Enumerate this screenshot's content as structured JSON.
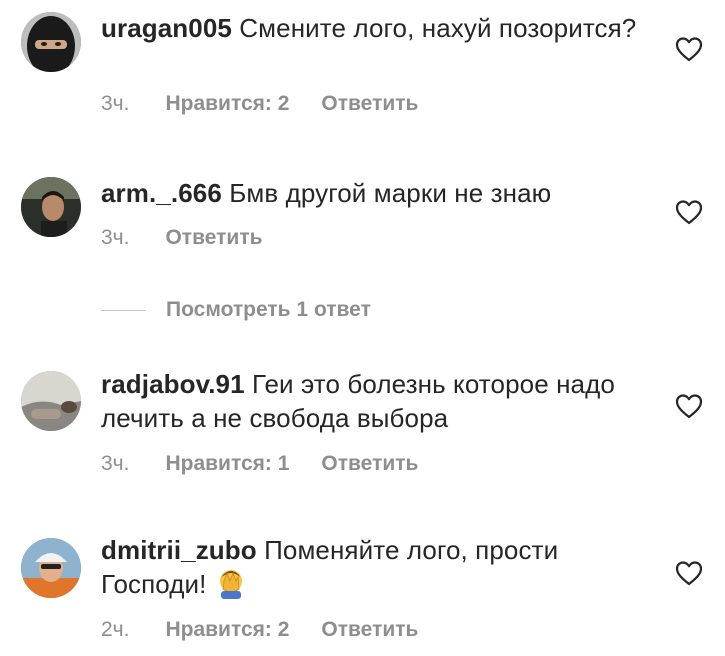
{
  "comments": [
    {
      "username": "uragan005",
      "text": "Смените лого, нахуй позорится?",
      "time": "3ч.",
      "likes": "Нравится: 2",
      "reply": "Ответить",
      "avatar_icon": "avatar-masked-person"
    },
    {
      "username": "arm._.666",
      "text": "Бмв другой марки  не знаю",
      "time": "3ч.",
      "likes": "",
      "reply": "Ответить",
      "avatar_icon": "avatar-man-in-car"
    },
    {
      "username": "radjabov.91",
      "text": "Геи это болезнь которое надо лечить а не свобода выбора",
      "time": "3ч.",
      "likes": "Нравится: 1",
      "reply": "Ответить",
      "avatar_icon": "avatar-hand-photo"
    },
    {
      "username": "dmitrii_zubo",
      "text": "Поменяйте лого, прости Господи!",
      "time": "2ч.",
      "likes": "Нравится: 2",
      "reply": "Ответить",
      "avatar_icon": "avatar-man-with-cap",
      "emoji": "face-palm-emoji"
    }
  ],
  "view_replies": "Посмотреть 1 ответ",
  "icons": {
    "like": "heart-outline-icon"
  },
  "colors": {
    "text": "#262626",
    "secondary": "#8e8e8e",
    "divider": "#c7c7c7"
  }
}
